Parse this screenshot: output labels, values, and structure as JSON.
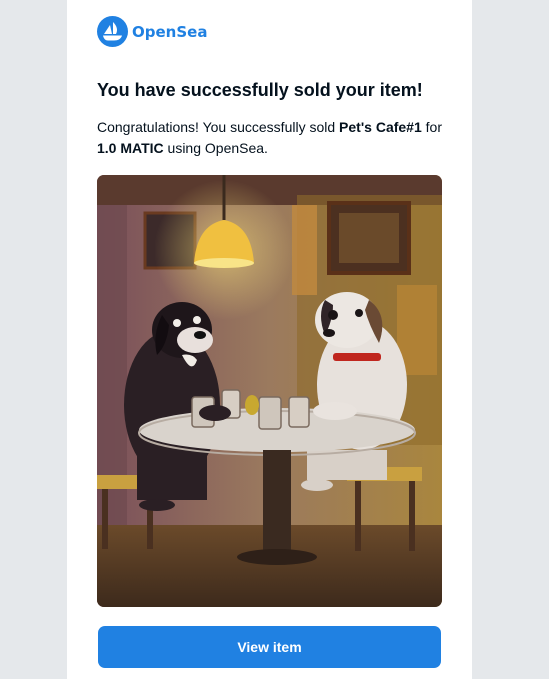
{
  "brand": {
    "name": "OpenSea",
    "logo_icon": "opensea-ship-icon",
    "color": "#2081e2"
  },
  "email": {
    "heading": "You have successfully sold your item!",
    "message_prefix": "Congratulations! You successfully sold ",
    "item_name": "Pet's Cafe#1",
    "message_middle": " for",
    "price": "1.0 MATIC",
    "message_suffix": " using OpenSea.",
    "image_description": "painting-two-dogs-at-cafe-table",
    "button_label": "View item"
  },
  "colors": {
    "page_bg": "#e5e8eb",
    "card_bg": "#ffffff",
    "text": "#04111d",
    "button": "#2081e2"
  }
}
